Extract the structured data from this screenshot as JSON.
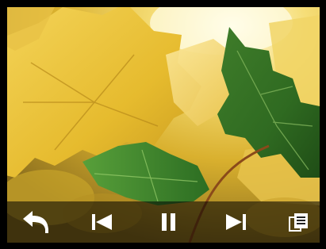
{
  "viewer": {
    "content": "photo-autumn-leaves"
  },
  "controls": [
    {
      "name": "back",
      "icon": "back-arrow-icon"
    },
    {
      "name": "previous",
      "icon": "skip-previous-icon"
    },
    {
      "name": "pause",
      "icon": "pause-icon"
    },
    {
      "name": "next",
      "icon": "skip-next-icon"
    },
    {
      "name": "menu",
      "icon": "menu-list-icon"
    }
  ],
  "colors": {
    "control_bar": "#000000",
    "icon": "#ffffff",
    "frame": "#000000"
  }
}
